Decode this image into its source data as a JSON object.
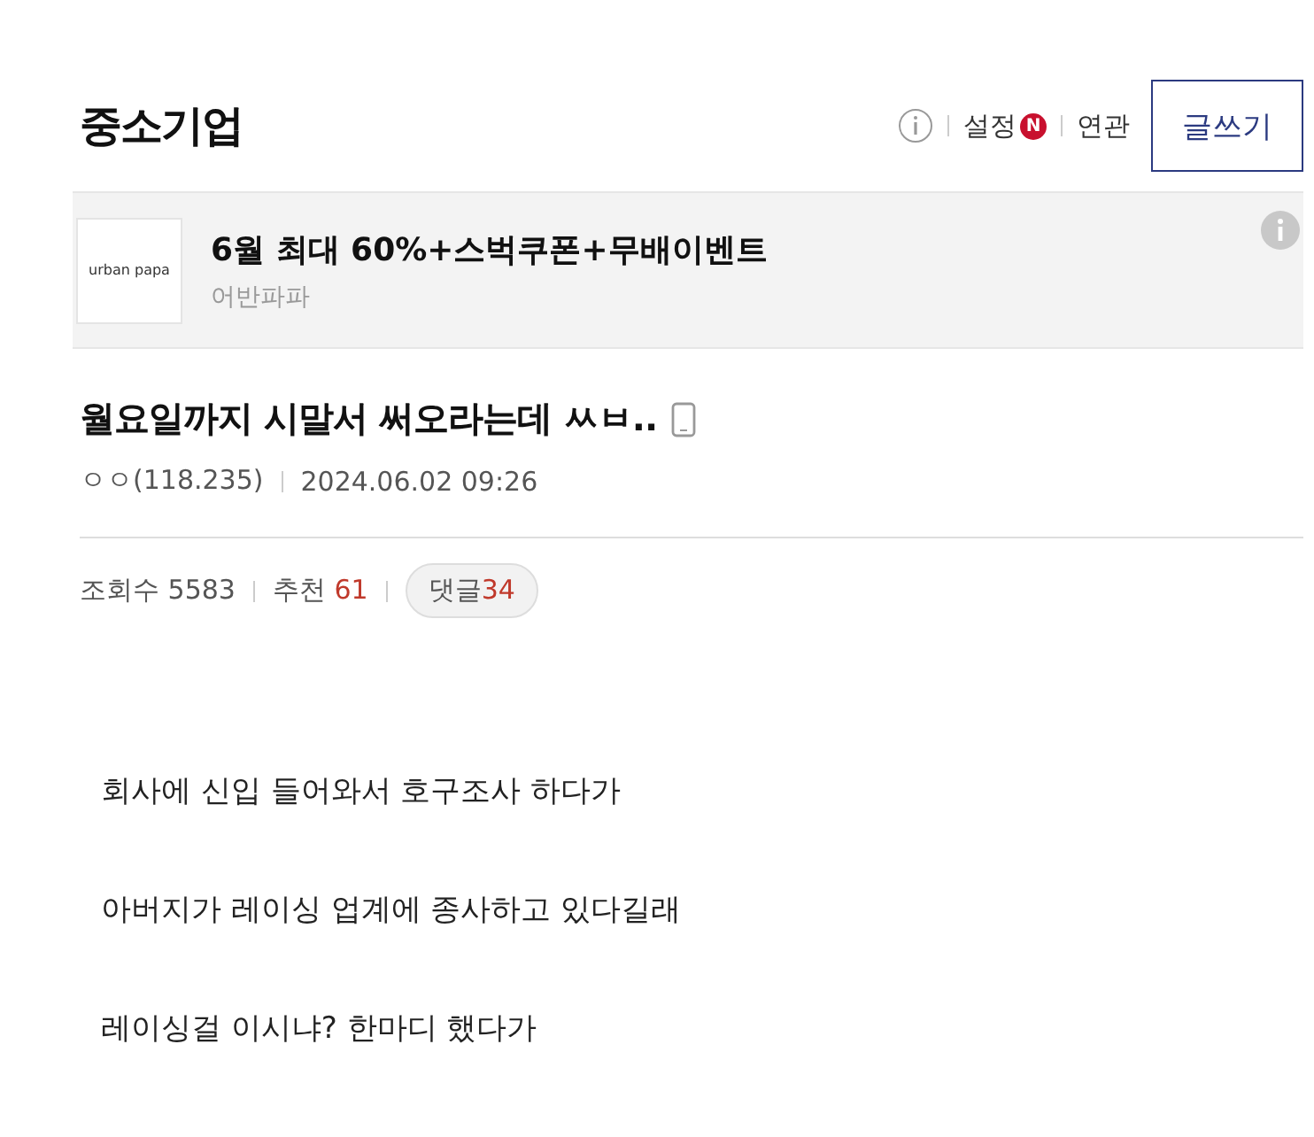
{
  "board": {
    "title": "중소기업",
    "settings_label": "설정",
    "settings_badge": "N",
    "related_label": "연관",
    "write_button": "글쓰기"
  },
  "ad": {
    "logo": "urban papa",
    "title": "6월 최대 60%+스벅쿠폰+무배이벤트",
    "advertiser": "어반파파"
  },
  "post": {
    "title": "월요일까지 시말서 써오라는데 ㅆㅂ..",
    "author": "ㅇㅇ(118.235)",
    "date": "2024.06.02 09:26"
  },
  "stats": [
    {
      "label": "조회수",
      "value": "5583",
      "kind": "plain"
    },
    {
      "label": "추천",
      "value": "61",
      "kind": "highlight"
    }
  ],
  "comments": {
    "label": "댓글",
    "value": "34"
  },
  "body": [
    "회사에 신입 들어와서 호구조사 하다가",
    "아버지가 레이싱 업계에 종사하고 있다길래",
    "레이싱걸 이시냐? 한마디 했다가"
  ]
}
